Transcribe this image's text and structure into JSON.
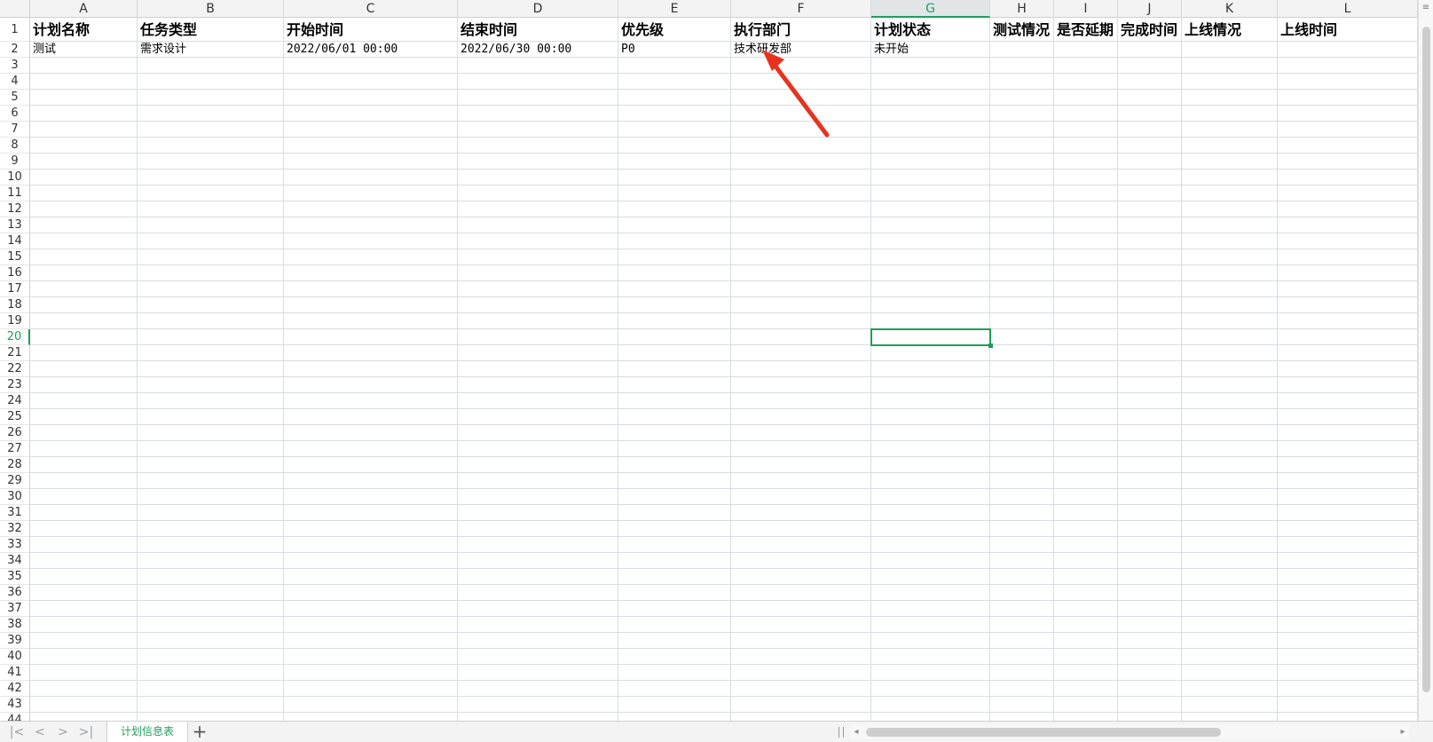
{
  "columns": [
    "A",
    "B",
    "C",
    "D",
    "E",
    "F",
    "G",
    "H",
    "I",
    "J",
    "K",
    "L"
  ],
  "active_column": "G",
  "active_row": 20,
  "row_count": 44,
  "headers": [
    "计划名称",
    "任务类型",
    "开始时间",
    "结束时间",
    "优先级",
    "执行部门",
    "计划状态",
    "测试情况",
    "是否延期",
    "完成时间",
    "上线情况",
    "上线时间"
  ],
  "rows": [
    [
      "测试",
      "需求设计",
      "2022/06/01 00:00",
      "2022/06/30 00:00",
      "P0",
      "技术研发部",
      "未开始",
      "",
      "",
      "",
      "",
      ""
    ]
  ],
  "sheet_tab": "计划信息表",
  "add_sheet_icon": "plus-icon",
  "nav_icons": [
    "first-sheet-icon",
    "prev-sheet-icon",
    "next-sheet-icon",
    "last-sheet-icon"
  ],
  "colors": {
    "accent": "#1f9d5c",
    "annotation_arrow": "#e8321f",
    "grid": "#d7dde3"
  }
}
